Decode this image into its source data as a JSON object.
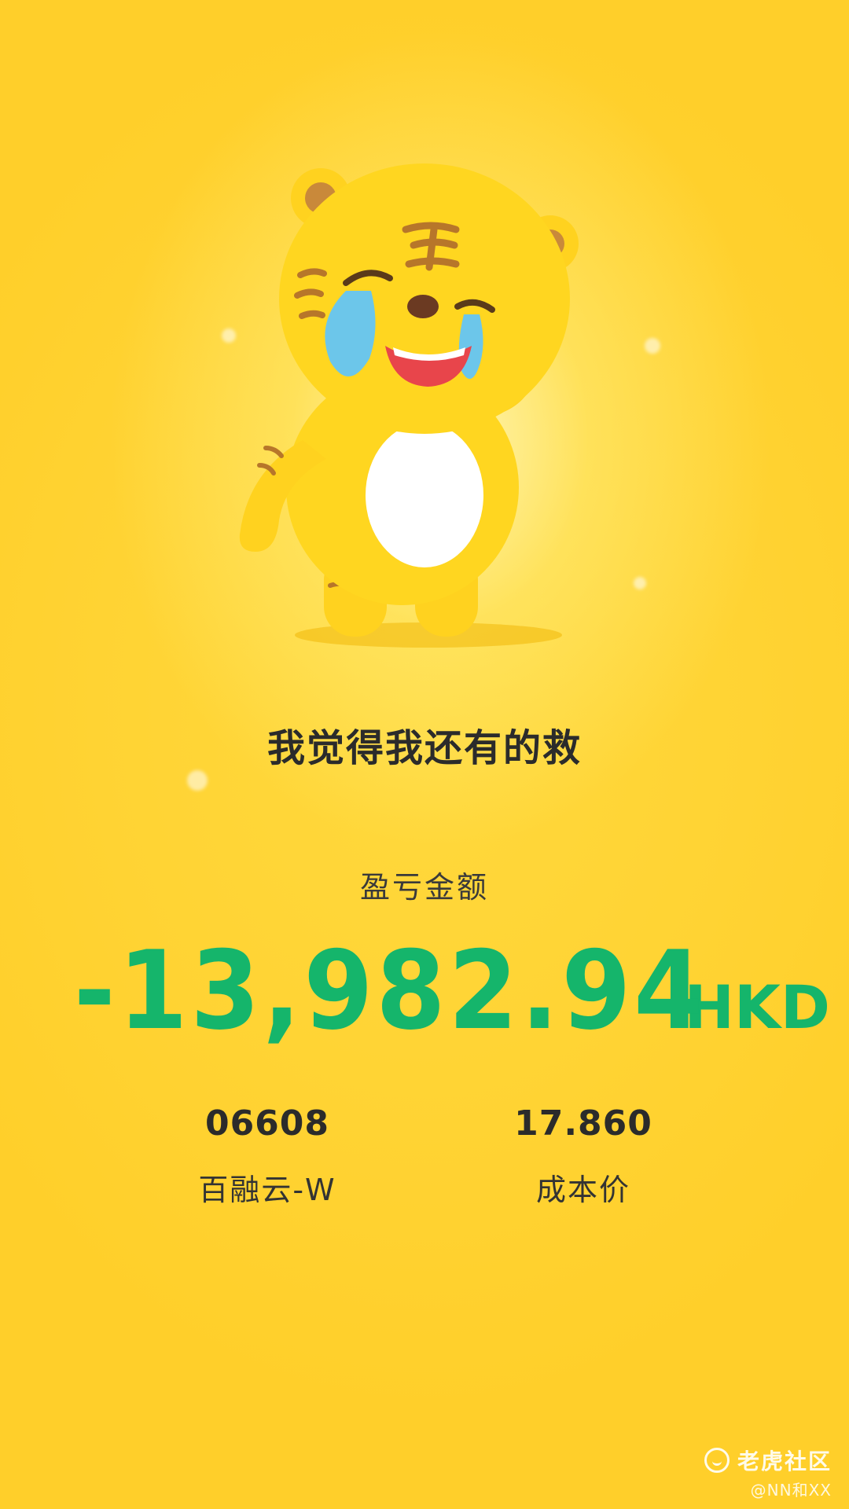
{
  "message": "我觉得我还有的救",
  "pnl": {
    "label": "盈亏金额",
    "value": "-13,982.94",
    "currency": "HKD",
    "color": "#15b56b"
  },
  "stock": {
    "code": "06608",
    "name": "百融云-W"
  },
  "cost": {
    "value": "17.860",
    "label": "成本价"
  },
  "watermark": {
    "brand": "老虎社区",
    "handle": "@NN和XX",
    "icon": "tiger-logo-icon"
  },
  "mascot": {
    "icon": "crying-tiger-mascot"
  }
}
